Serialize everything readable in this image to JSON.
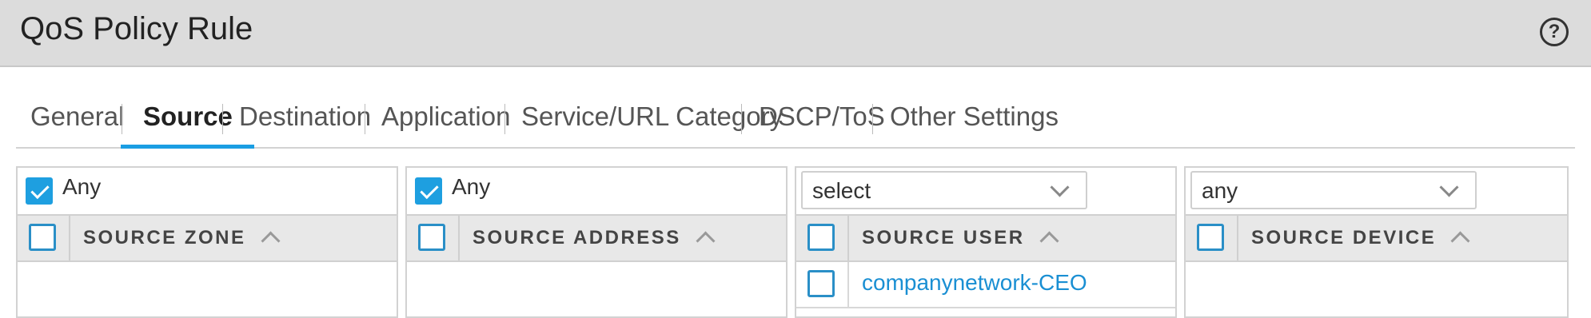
{
  "title": "QoS Policy Rule",
  "help_glyph": "?",
  "tabs": [
    {
      "label": "General",
      "active": false
    },
    {
      "label": "Source",
      "active": true
    },
    {
      "label": "Destination",
      "active": false
    },
    {
      "label": "Application",
      "active": false
    },
    {
      "label": "Service/URL Category",
      "active": false
    },
    {
      "label": "DSCP/ToS",
      "active": false
    },
    {
      "label": "Other Settings",
      "active": false
    }
  ],
  "panels": {
    "zone": {
      "any_label": "Any",
      "any_checked": true,
      "header": "SOURCE ZONE"
    },
    "address": {
      "any_label": "Any",
      "any_checked": true,
      "header": "SOURCE ADDRESS"
    },
    "user": {
      "select_value": "select",
      "header": "SOURCE USER",
      "rows": [
        "companynetwork-CEO"
      ]
    },
    "device": {
      "select_value": "any",
      "header": "SOURCE DEVICE"
    }
  },
  "colors": {
    "accent": "#1a9ee3",
    "link": "#1a8fd3",
    "titlebar": "#dcdcdc"
  }
}
